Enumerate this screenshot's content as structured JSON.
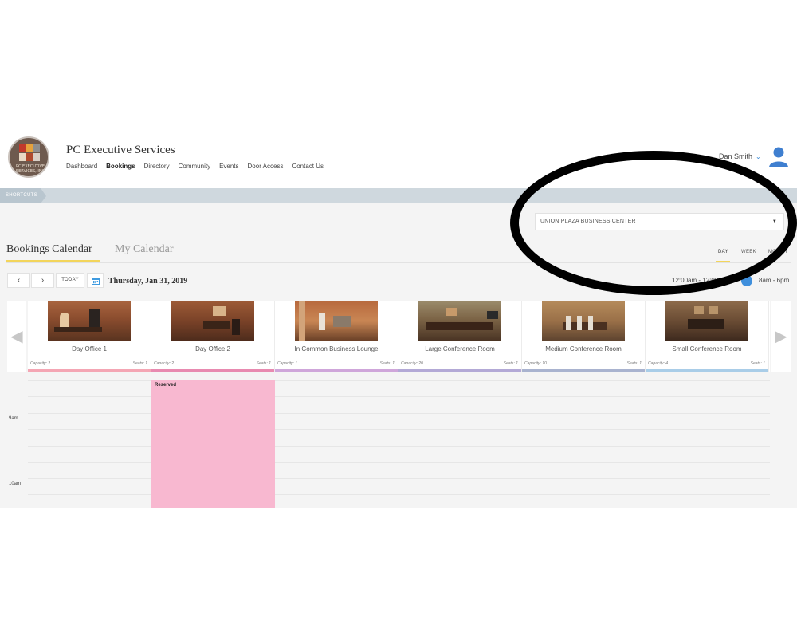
{
  "header": {
    "brand": "PC Executive Services",
    "logo_text": "PC EXECUTIVE SERVICES, INC",
    "nav": [
      "Dashboard",
      "Bookings",
      "Directory",
      "Community",
      "Events",
      "Door Access",
      "Contact Us"
    ],
    "active_nav": "Bookings",
    "user_name": "Dan Smith",
    "user_icon": "user-avatar-icon"
  },
  "shortcuts": {
    "label": "SHORTCUTS"
  },
  "location": {
    "selected": "UNION PLAZA BUSINESS CENTER"
  },
  "tabs": {
    "bookings": "Bookings Calendar",
    "my_calendar": "My Calendar"
  },
  "views": {
    "day": "DAY",
    "week": "WEEK",
    "month": "MONTH",
    "active": "DAY"
  },
  "toolbar": {
    "prev": "‹",
    "next": "›",
    "today": "TODAY",
    "calendar_icon": "calendar-icon",
    "date": "Thursday, Jan 31, 2019",
    "range_full": "12:00am - 12:00am",
    "range_default": "8am - 6pm"
  },
  "rooms": [
    {
      "name": "Day Office 1",
      "capacity": "Capacity: 2",
      "seats": "Seats: 1",
      "color": "#f4a6b4"
    },
    {
      "name": "Day Office 2",
      "capacity": "Capacity: 2",
      "seats": "Seats: 1",
      "color": "#e88ab0"
    },
    {
      "name": "In Common Business Lounge",
      "capacity": "Capacity: 1",
      "seats": "Seats: 1",
      "color": "#cfa6da"
    },
    {
      "name": "Large Conference Room",
      "capacity": "Capacity: 20",
      "seats": "Seats: 1",
      "color": "#b3a9d6"
    },
    {
      "name": "Medium Conference Room",
      "capacity": "Capacity: 10",
      "seats": "Seats: 1",
      "color": "#a9b3cf"
    },
    {
      "name": "Small Conference Room",
      "capacity": "Capacity: 4",
      "seats": "Seats: 1",
      "color": "#a9cde8"
    }
  ],
  "schedule": {
    "times": [
      "9am",
      "10am"
    ],
    "reservation": {
      "label": "Reserved",
      "room": "Day Office 2",
      "color": "#f8b8d0"
    }
  }
}
